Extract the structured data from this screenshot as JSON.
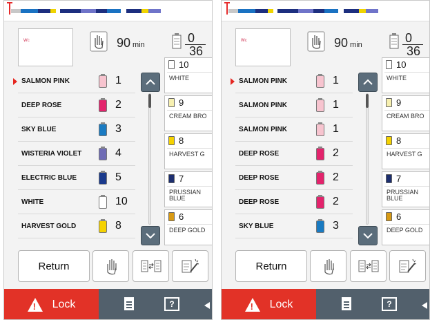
{
  "strip": [
    "#c8c8c8",
    "#1a72c2",
    "#1d2f7f",
    "#f0d400",
    "#ffffff",
    "#1d2f7f",
    "#6f74c9",
    "#1d2f7f",
    "#1a72c2",
    "#ffffff",
    "#1d2f7f",
    "#f0d400",
    "#6f74c9"
  ],
  "time": {
    "value": "90",
    "unit": "min"
  },
  "count": {
    "top": "0",
    "bottom": "36"
  },
  "preview_mark": "ᵂᶜ",
  "buttons": {
    "return": "Return"
  },
  "status": {
    "lock": "Lock",
    "help": "?"
  },
  "screens": [
    {
      "rows": [
        {
          "name": "SALMON PINK",
          "num": "1",
          "color": "#f7c4cf",
          "current": true
        },
        {
          "name": "DEEP ROSE",
          "num": "2",
          "color": "#e3236c"
        },
        {
          "name": "SKY BLUE",
          "num": "3",
          "color": "#1a7bc2"
        },
        {
          "name": "WISTERIA VIOLET",
          "num": "4",
          "color": "#6f6cb5"
        },
        {
          "name": "ELECTRIC BLUE",
          "num": "5",
          "color": "#1a3a8c"
        },
        {
          "name": "WHITE",
          "num": "10",
          "color": "#ffffff"
        },
        {
          "name": "HARVEST GOLD",
          "num": "8",
          "color": "#f5d200"
        }
      ]
    },
    {
      "rows": [
        {
          "name": "SALMON PINK",
          "num": "1",
          "color": "#f7c4cf",
          "current": true
        },
        {
          "name": "SALMON PINK",
          "num": "1",
          "color": "#f7c4cf"
        },
        {
          "name": "SALMON PINK",
          "num": "1",
          "color": "#f7c4cf"
        },
        {
          "name": "DEEP ROSE",
          "num": "2",
          "color": "#e3236c"
        },
        {
          "name": "DEEP ROSE",
          "num": "2",
          "color": "#e3236c"
        },
        {
          "name": "DEEP ROSE",
          "num": "2",
          "color": "#e3236c"
        },
        {
          "name": "SKY BLUE",
          "num": "3",
          "color": "#1a7bc2"
        }
      ]
    }
  ],
  "palette": [
    {
      "num": "10",
      "name": "WHITE",
      "color": "#ffffff"
    },
    {
      "num": "9",
      "name": "CREAM BRO",
      "color": "#f7f0b0"
    },
    {
      "num": "8",
      "name": "HARVEST G",
      "color": "#f5d200"
    },
    {
      "num": "7",
      "name": "PRUSSIAN\nBLUE",
      "color": "#1d2f6f"
    },
    {
      "num": "6",
      "name": "DEEP GOLD",
      "color": "#d89a14"
    }
  ]
}
